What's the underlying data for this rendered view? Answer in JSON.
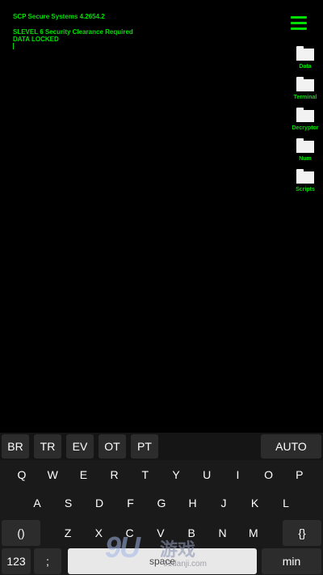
{
  "terminal": {
    "line1": "SCP Secure Systems 4.2654.2",
    "line2": "SLEVEL 6 Security Clearance Required",
    "line3": "DATA LOCKED"
  },
  "sidebar": {
    "items": [
      {
        "label": "Data",
        "icon": "folder-icon"
      },
      {
        "label": "Terminal",
        "icon": "folder-icon"
      },
      {
        "label": "Decryptor",
        "icon": "folder-icon"
      },
      {
        "label": "Num",
        "icon": "folder-icon"
      },
      {
        "label": "Scripts",
        "icon": "folder-icon"
      }
    ],
    "menu_icon": "hamburger-icon"
  },
  "keyboard": {
    "suggestions": [
      "BR",
      "TR",
      "EV",
      "OT",
      "PT"
    ],
    "auto": "AUTO",
    "row1": [
      "Q",
      "W",
      "E",
      "R",
      "T",
      "Y",
      "U",
      "I",
      "O",
      "P"
    ],
    "row2": [
      "A",
      "S",
      "D",
      "F",
      "G",
      "H",
      "J",
      "K",
      "L"
    ],
    "row3_left": "()",
    "row3": [
      "Z",
      "X",
      "C",
      "V",
      "B",
      "N",
      "M"
    ],
    "row3_right": "{}",
    "num": "123",
    "semicolon": ";",
    "space": "space",
    "min": "min"
  },
  "watermark": {
    "big": "9U",
    "cn": "游戏",
    "url": "91danji.com"
  },
  "colors": {
    "terminal_green": "#00e000",
    "background": "#000000",
    "keyboard_bg": "#1a1a1a"
  }
}
